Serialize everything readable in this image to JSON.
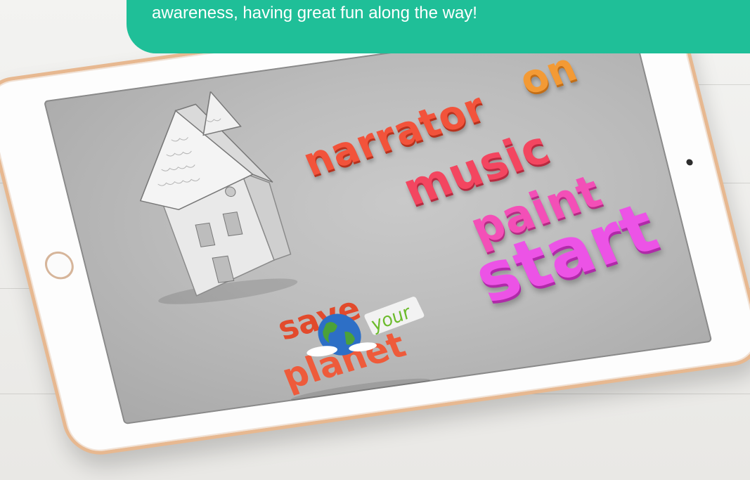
{
  "banner": {
    "text": "awareness, having great fun along the way!",
    "color": "#1fbf98"
  },
  "menu": {
    "narrator": "narrator",
    "on": "on",
    "music": "music",
    "paint": "paint",
    "start": "start"
  },
  "logo": {
    "line1": "save",
    "line2": "your",
    "line3": "planet"
  },
  "icons": [
    "house-illustration",
    "globe-icon",
    "home-button",
    "front-camera"
  ]
}
